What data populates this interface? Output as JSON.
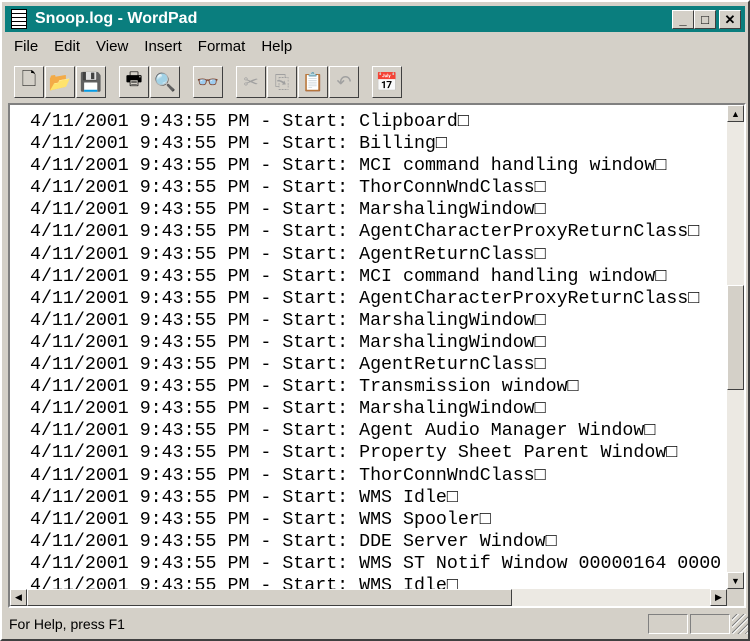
{
  "window": {
    "title": "Snoop.log - WordPad",
    "minimize": "_",
    "maximize": "□",
    "close": "✕"
  },
  "menu": [
    "File",
    "Edit",
    "View",
    "Insert",
    "Format",
    "Help"
  ],
  "toolbar": [
    {
      "name": "new-icon",
      "glyph": "🗋"
    },
    {
      "name": "open-icon",
      "glyph": "📂"
    },
    {
      "name": "save-icon",
      "glyph": "💾"
    },
    {
      "name": "print-icon",
      "glyph": "🖶"
    },
    {
      "name": "print-preview-icon",
      "glyph": "🔍"
    },
    {
      "name": "find-icon",
      "glyph": "👓"
    },
    {
      "name": "cut-icon",
      "glyph": "✂"
    },
    {
      "name": "copy-icon",
      "glyph": "⎘"
    },
    {
      "name": "paste-icon",
      "glyph": "📋"
    },
    {
      "name": "undo-icon",
      "glyph": "↶"
    },
    {
      "name": "date-time-icon",
      "glyph": "📅"
    }
  ],
  "lines": [
    "4/11/2001 9:43:55 PM - Start: Clipboard□",
    "4/11/2001 9:43:55 PM - Start: Billing□",
    "4/11/2001 9:43:55 PM - Start: MCI command handling window□",
    "4/11/2001 9:43:55 PM - Start: ThorConnWndClass□",
    "4/11/2001 9:43:55 PM - Start: MarshalingWindow□",
    "4/11/2001 9:43:55 PM - Start: AgentCharacterProxyReturnClass□",
    "4/11/2001 9:43:55 PM - Start: AgentReturnClass□",
    "4/11/2001 9:43:55 PM - Start: MCI command handling window□",
    "4/11/2001 9:43:55 PM - Start: AgentCharacterProxyReturnClass□",
    "4/11/2001 9:43:55 PM - Start: MarshalingWindow□",
    "4/11/2001 9:43:55 PM - Start: MarshalingWindow□",
    "4/11/2001 9:43:55 PM - Start: AgentReturnClass□",
    "4/11/2001 9:43:55 PM - Start: Transmission window□",
    "4/11/2001 9:43:55 PM - Start: MarshalingWindow□",
    "4/11/2001 9:43:55 PM - Start: Agent Audio Manager Window□",
    "4/11/2001 9:43:55 PM - Start: Property Sheet Parent Window□",
    "4/11/2001 9:43:55 PM - Start: ThorConnWndClass□",
    "4/11/2001 9:43:55 PM - Start: WMS Idle□",
    "4/11/2001 9:43:55 PM - Start: WMS Spooler□",
    "4/11/2001 9:43:55 PM - Start: DDE Server Window□",
    "4/11/2001 9:43:55 PM - Start: WMS ST Notif Window 00000164 0000",
    "4/11/2001 9:43:55 PM - Start: WMS Idle□"
  ],
  "status": {
    "message": "For Help, press F1"
  }
}
